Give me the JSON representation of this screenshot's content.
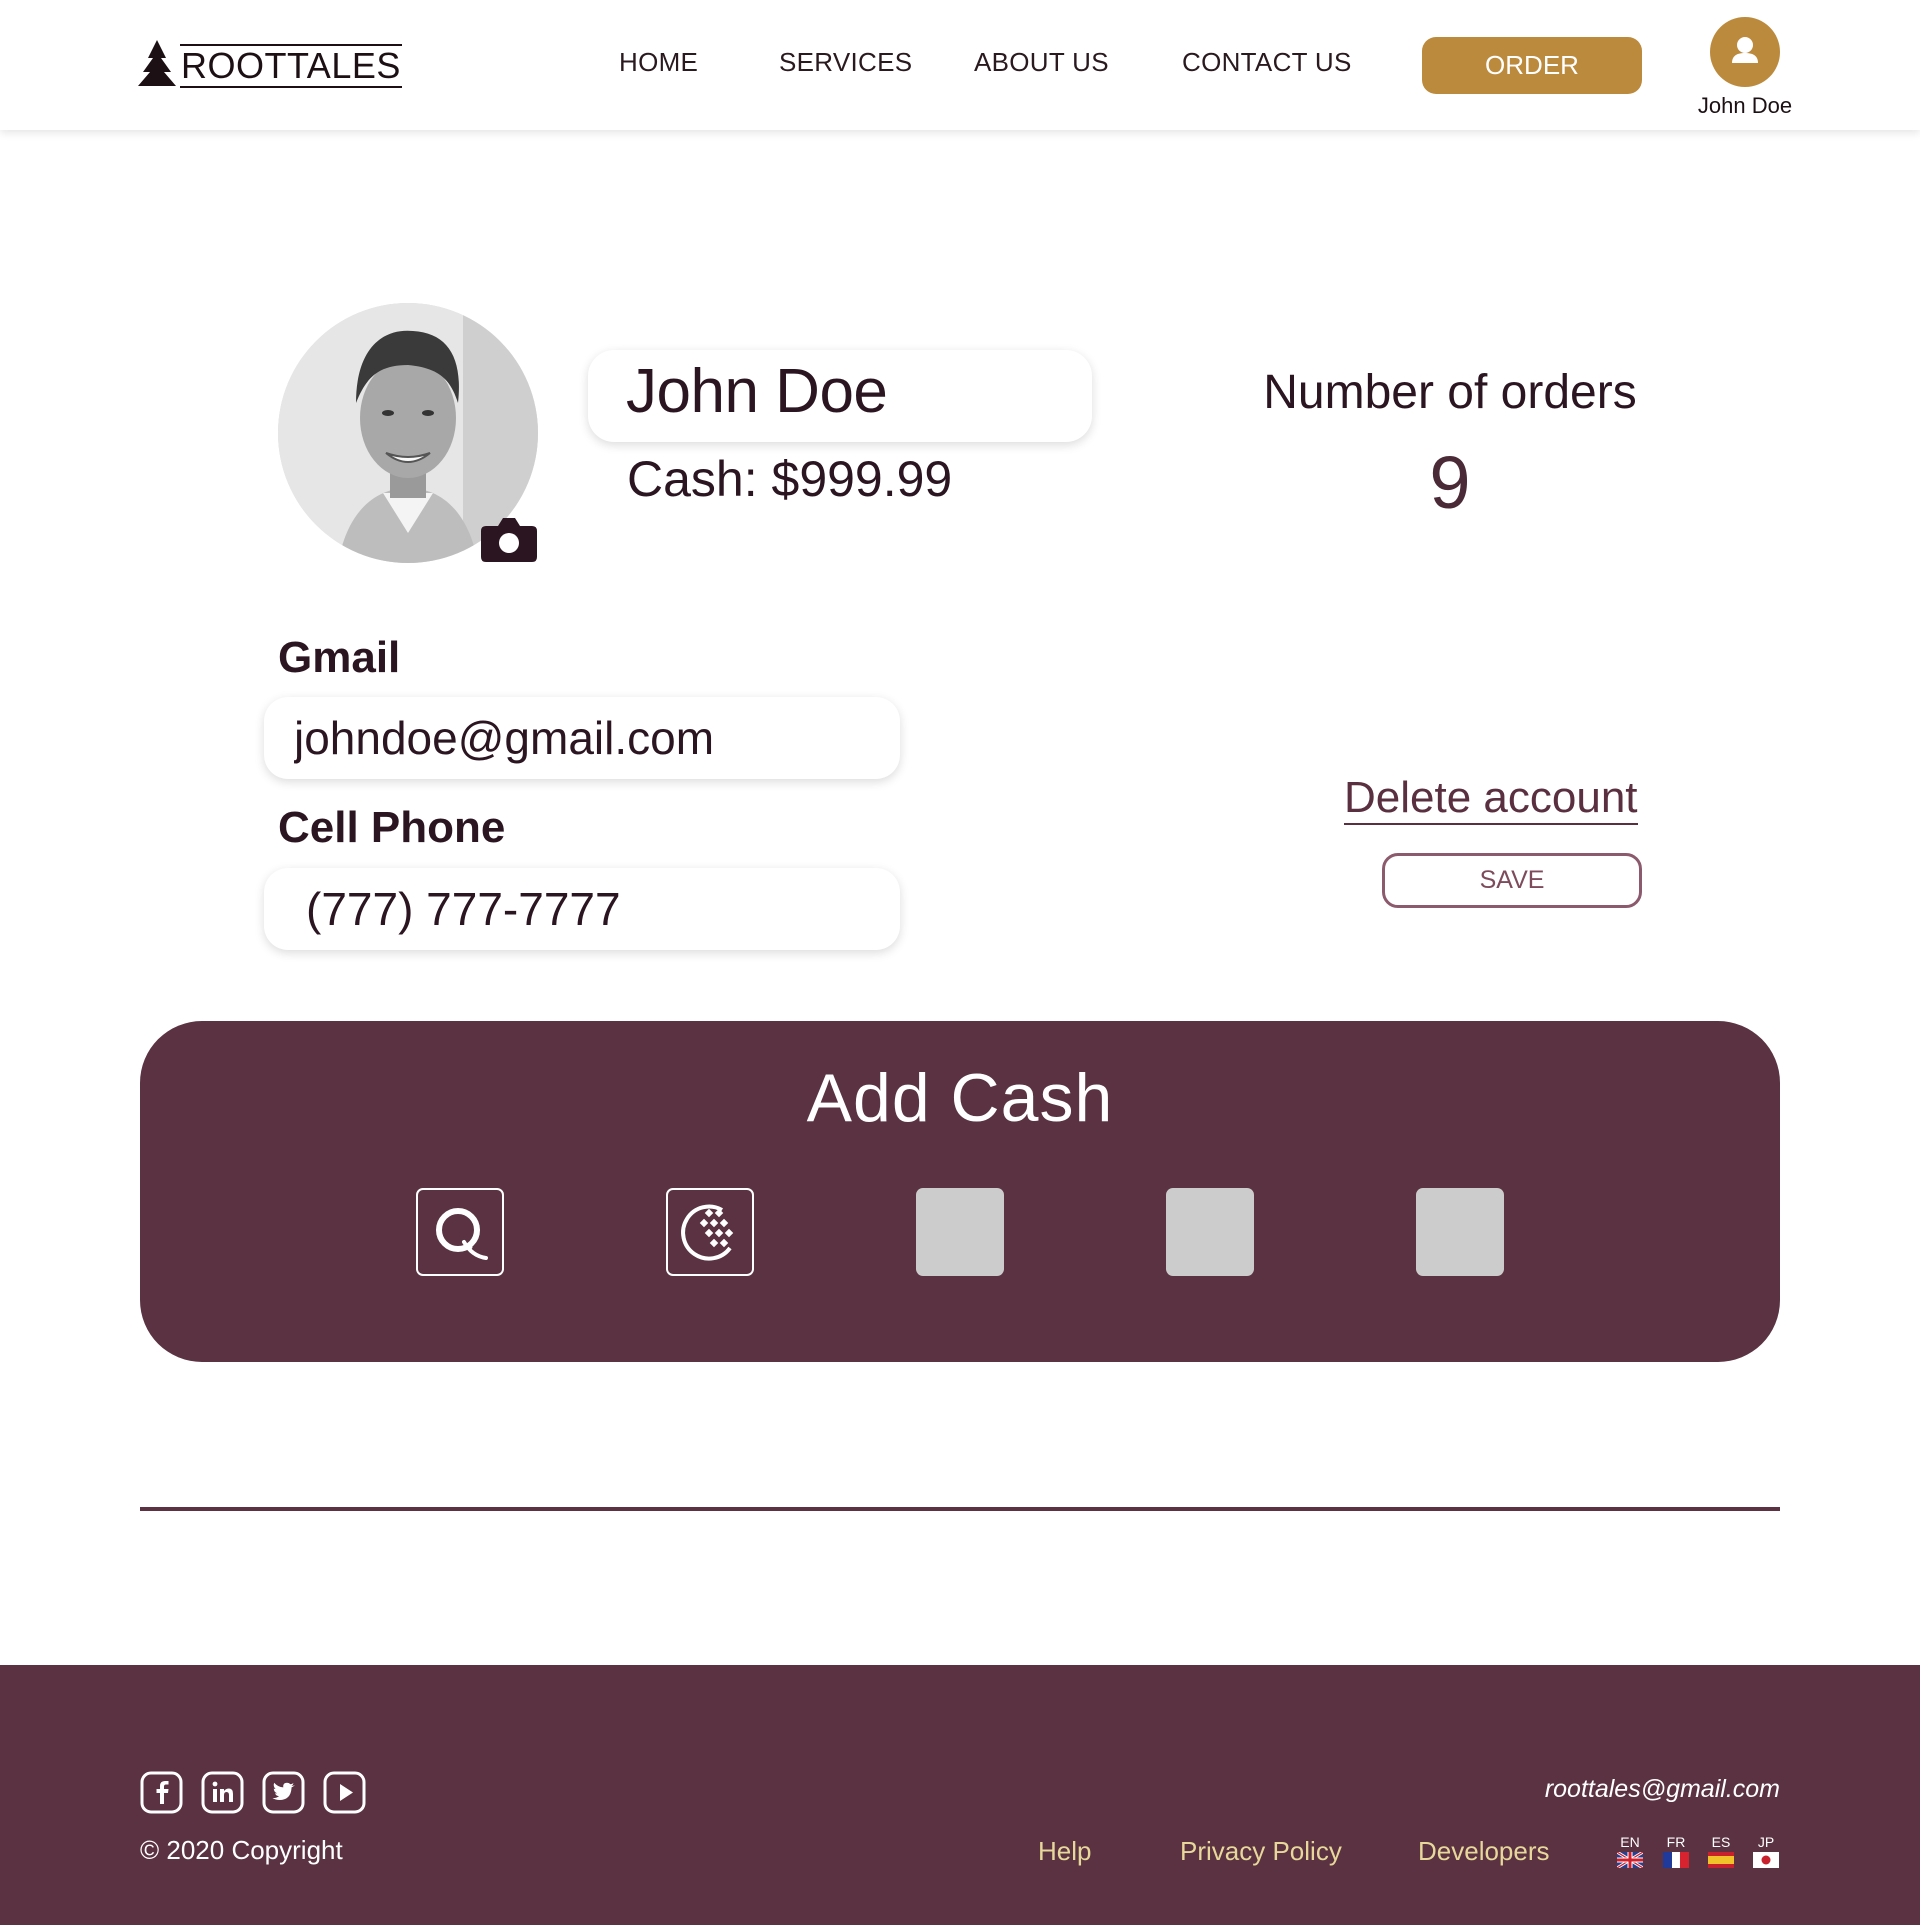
{
  "header": {
    "logo_text": "ROOTTALES",
    "nav": {
      "home": "HOME",
      "services": "SERVICES",
      "about": "ABOUT US",
      "contact": "CONTACT US"
    },
    "order_label": "ORDER",
    "user_name": "John Doe",
    "accent_color": "#bc8a3d"
  },
  "profile": {
    "name": "John Doe",
    "cash": "Cash: $999.99",
    "orders_label": "Number of orders",
    "orders_count": "9",
    "photo_icon": "camera-icon"
  },
  "form": {
    "gmail_label": "Gmail",
    "gmail_value": "johndoe@gmail.com",
    "phone_label": "Cell Phone",
    "phone_value": "(777) 777-7777",
    "delete_label": "Delete account",
    "save_label": "SAVE"
  },
  "add_cash": {
    "title": "Add Cash",
    "panel_color": "#5a3241",
    "methods": [
      "qiwi-icon",
      "webmoney-icon",
      "placeholder",
      "placeholder",
      "placeholder"
    ]
  },
  "footer": {
    "social": [
      "facebook-icon",
      "linkedin-icon",
      "twitter-icon",
      "youtube-icon"
    ],
    "copyright": "© 2020 Copyright",
    "email": "roottales@gmail.com",
    "links": {
      "help": "Help",
      "privacy": "Privacy Policy",
      "developers": "Developers"
    },
    "languages": [
      "EN",
      "FR",
      "ES",
      "JP"
    ],
    "link_color": "#e7d79b"
  }
}
